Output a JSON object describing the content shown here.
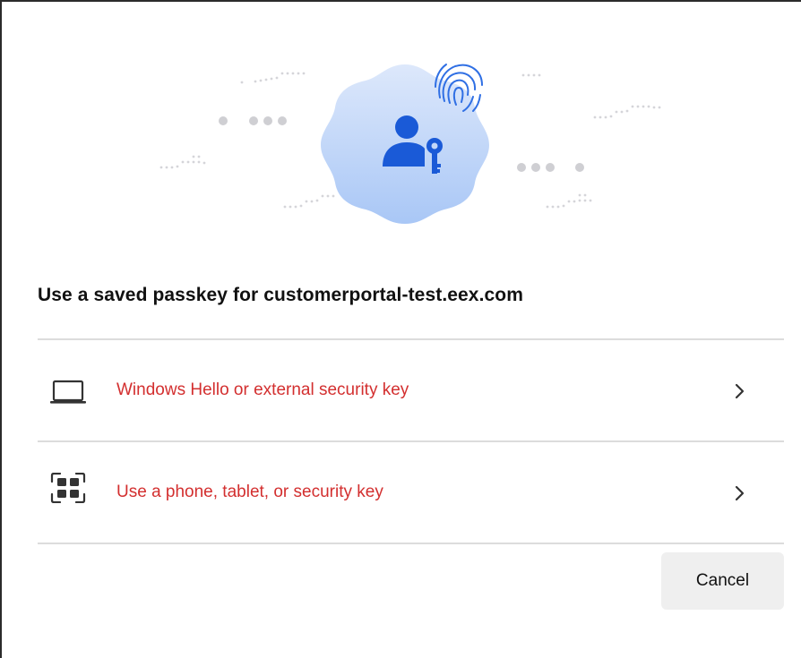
{
  "dialog": {
    "title": "Use a saved passkey for customerportal-test.eex.com",
    "hero_icon": "user-key-icon",
    "hero_badge_icon": "fingerprint-icon",
    "options": [
      {
        "label": "Windows Hello or external security key",
        "icon": "laptop-icon"
      },
      {
        "label": "Use a phone, tablet, or security key",
        "icon": "qr-code-icon"
      }
    ],
    "cancel_label": "Cancel"
  },
  "colors": {
    "option_text": "#d32f2f",
    "hero_icon": "#1a5ad7",
    "hero_blob_top": "#d9e6fb",
    "hero_blob_bottom": "#a8c6f5",
    "divider": "#dcdcdc",
    "cancel_bg": "#efefef"
  }
}
